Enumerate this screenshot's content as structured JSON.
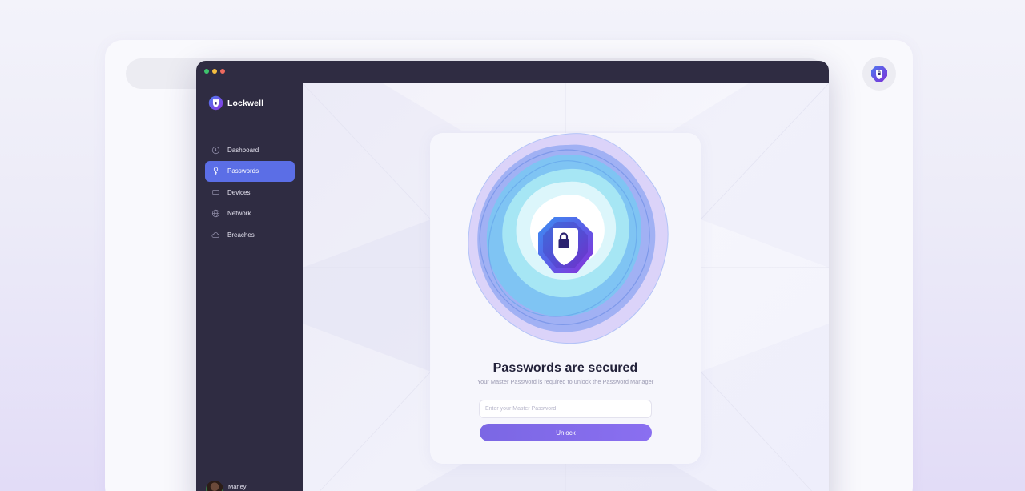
{
  "app": {
    "name": "Lockwell"
  },
  "sidebar": {
    "items": [
      {
        "label": "Dashboard",
        "icon": "dashboard-icon"
      },
      {
        "label": "Passwords",
        "icon": "key-icon",
        "active": true
      },
      {
        "label": "Devices",
        "icon": "devices-icon"
      },
      {
        "label": "Network",
        "icon": "network-icon"
      },
      {
        "label": "Breaches",
        "icon": "cloud-icon"
      }
    ],
    "user": {
      "name": "Marley"
    }
  },
  "unlock": {
    "title": "Passwords are secured",
    "subtitle": "Your Master Password is required to unlock the Password Manager",
    "placeholder": "Enter your Master Password",
    "button": "Unlock"
  },
  "colors": {
    "accent": "#5b6ee6",
    "button": "#7b67e4",
    "sidebar": "#2f2c42",
    "shield_blue": "#4f7bf0",
    "shield_purple": "#7d2fd6"
  }
}
